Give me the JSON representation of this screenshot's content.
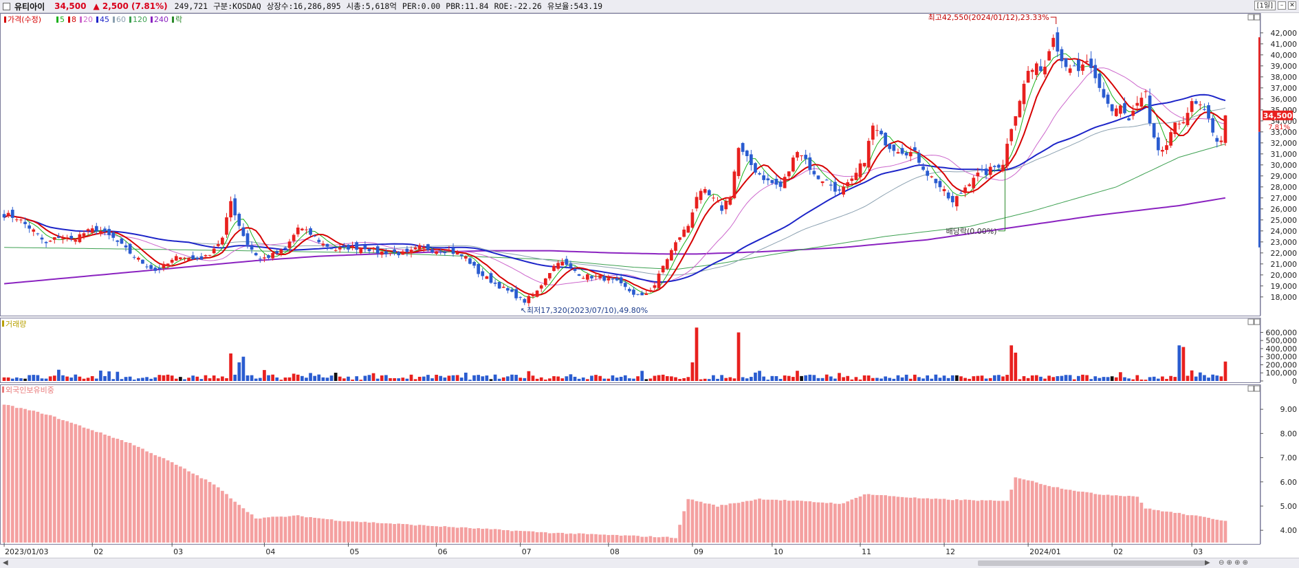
{
  "header": {
    "name": "유티아이",
    "price": "34,500",
    "change": "▲ 2,500 (7.81%)",
    "volume": "249,721",
    "market": "구분:KOSDAQ",
    "shares": "상장수:16,286,895",
    "marketcap": "시총:5,618억",
    "per": "PER:0.00",
    "pbr": "PBR:11.84",
    "roe": "ROE:-22.26",
    "float": "유보율:543.19",
    "period_button": "[1일]"
  },
  "legend": [
    {
      "label": "가격(수정)",
      "color": "#d60000"
    },
    {
      "label": "5",
      "color": "#19b019"
    },
    {
      "label": "8",
      "color": "#d60000"
    },
    {
      "label": "20",
      "color": "#cc66cc"
    },
    {
      "label": "45",
      "color": "#1c24c8"
    },
    {
      "label": "60",
      "color": "#8aa0b0"
    },
    {
      "label": "120",
      "color": "#3ca050"
    },
    {
      "label": "240",
      "color": "#8a22c0"
    },
    {
      "label": "락",
      "color": "#2a8a2a"
    }
  ],
  "chart_data": [
    {
      "type": "candlestick",
      "title": "가격(수정)",
      "y_ticks": [
        18000,
        19000,
        20000,
        21000,
        22000,
        23000,
        24000,
        25000,
        26000,
        27000,
        28000,
        29000,
        30000,
        31000,
        32000,
        33000,
        34000,
        35000,
        36000,
        37000,
        38000,
        39000,
        40000,
        41000,
        42000
      ],
      "y_tick_labels": [
        "18,000",
        "19,000",
        "20,000",
        "21,000",
        "22,000",
        "23,000",
        "24,000",
        "25,000",
        "26,000",
        "27,000",
        "28,000",
        "29,000",
        "30,000",
        "31,000",
        "32,000",
        "33,000",
        "34,000",
        "35,000",
        "36,000",
        "37,000",
        "38,000",
        "39,000",
        "40,000",
        "41,000",
        "42,000"
      ],
      "ylim": [
        16800,
        43300
      ],
      "x_axis": {
        "labels": [
          "2023/01/03",
          "02",
          "03",
          "04",
          "05",
          "06",
          "07",
          "08",
          "09",
          "10",
          "11",
          "12",
          "2024/01",
          "02",
          "03"
        ],
        "positions": [
          0,
          21,
          40,
          62,
          82,
          103,
          123,
          144,
          164,
          183,
          204,
          224,
          244,
          264,
          283
        ]
      },
      "trading_days": 292,
      "price_path": [
        [
          0,
          25500
        ],
        [
          3,
          25200
        ],
        [
          7,
          24000
        ],
        [
          10,
          22800
        ],
        [
          13,
          23500
        ],
        [
          16,
          23200
        ],
        [
          19,
          23800
        ],
        [
          22,
          24200
        ],
        [
          26,
          23300
        ],
        [
          29,
          22300
        ],
        [
          33,
          21100
        ],
        [
          36,
          20400
        ],
        [
          39,
          21000
        ],
        [
          42,
          21800
        ],
        [
          45,
          21400
        ],
        [
          48,
          21600
        ],
        [
          52,
          23300
        ],
        [
          54,
          26700
        ],
        [
          56,
          24500
        ],
        [
          58,
          22800
        ],
        [
          61,
          21400
        ],
        [
          64,
          21800
        ],
        [
          67,
          22300
        ],
        [
          70,
          24300
        ],
        [
          73,
          23700
        ],
        [
          76,
          22800
        ],
        [
          79,
          22300
        ],
        [
          82,
          22500
        ],
        [
          86,
          22500
        ],
        [
          89,
          22100
        ],
        [
          93,
          22000
        ],
        [
          96,
          21900
        ],
        [
          99,
          22500
        ],
        [
          102,
          22300
        ],
        [
          106,
          22200
        ],
        [
          110,
          21600
        ],
        [
          113,
          20200
        ],
        [
          117,
          19200
        ],
        [
          121,
          18300
        ],
        [
          124,
          17600
        ],
        [
          127,
          18500
        ],
        [
          129,
          19800
        ],
        [
          132,
          21300
        ],
        [
          135,
          20600
        ],
        [
          138,
          19900
        ],
        [
          142,
          19800
        ],
        [
          146,
          19300
        ],
        [
          150,
          18300
        ],
        [
          152,
          18000
        ],
        [
          155,
          19100
        ],
        [
          157,
          20800
        ],
        [
          159,
          22200
        ],
        [
          161,
          23500
        ],
        [
          163,
          24500
        ],
        [
          165,
          27200
        ],
        [
          167,
          27500
        ],
        [
          169,
          26800
        ],
        [
          171,
          26000
        ],
        [
          173,
          27300
        ],
        [
          175,
          31500
        ],
        [
          177,
          30500
        ],
        [
          179,
          29500
        ],
        [
          182,
          28500
        ],
        [
          185,
          28000
        ],
        [
          187,
          29500
        ],
        [
          189,
          31500
        ],
        [
          191,
          30500
        ],
        [
          193,
          29000
        ],
        [
          196,
          28500
        ],
        [
          199,
          27500
        ],
        [
          202,
          28500
        ],
        [
          205,
          30500
        ],
        [
          207,
          33500
        ],
        [
          209,
          32500
        ],
        [
          211,
          31700
        ],
        [
          214,
          31300
        ],
        [
          217,
          31000
        ],
        [
          220,
          29200
        ],
        [
          222,
          28500
        ],
        [
          224,
          27500
        ],
        [
          226,
          26500
        ],
        [
          228,
          27500
        ],
        [
          231,
          29000
        ],
        [
          234,
          29300
        ],
        [
          236,
          29800
        ],
        [
          238,
          30200
        ],
        [
          240,
          33500
        ],
        [
          242,
          36000
        ],
        [
          244,
          38500
        ],
        [
          246,
          38800
        ],
        [
          248,
          39000
        ],
        [
          250,
          42000
        ],
        [
          252,
          39500
        ],
        [
          254,
          39000
        ],
        [
          256,
          38300
        ],
        [
          258,
          39500
        ],
        [
          260,
          37500
        ],
        [
          262,
          36000
        ],
        [
          264,
          35000
        ],
        [
          266,
          35400
        ],
        [
          268,
          34000
        ],
        [
          270,
          35500
        ],
        [
          272,
          36500
        ],
        [
          273,
          33500
        ],
        [
          275,
          31000
        ],
        [
          277,
          31800
        ],
        [
          279,
          33500
        ],
        [
          281,
          34200
        ],
        [
          283,
          35500
        ],
        [
          285,
          35300
        ],
        [
          287,
          34000
        ],
        [
          289,
          32300
        ],
        [
          290,
          32000
        ],
        [
          291,
          34500
        ]
      ],
      "moving_averages": {
        "MA240_anchors": [
          [
            0,
            19200
          ],
          [
            20,
            19900
          ],
          [
            40,
            20600
          ],
          [
            60,
            21300
          ],
          [
            75,
            21700
          ],
          [
            95,
            22000
          ],
          [
            115,
            22200
          ],
          [
            130,
            22200
          ],
          [
            145,
            22000
          ],
          [
            158,
            21900
          ],
          [
            165,
            21900
          ],
          [
            180,
            22100
          ],
          [
            200,
            22500
          ],
          [
            220,
            23200
          ],
          [
            240,
            24300
          ],
          [
            260,
            25400
          ],
          [
            280,
            26300
          ],
          [
            291,
            27000
          ]
        ],
        "MA120_anchors": [
          [
            0,
            22500
          ],
          [
            40,
            22300
          ],
          [
            90,
            22000
          ],
          [
            130,
            21400
          ],
          [
            150,
            20700
          ],
          [
            160,
            20500
          ],
          [
            170,
            21000
          ],
          [
            190,
            22300
          ],
          [
            210,
            23500
          ],
          [
            230,
            24400
          ],
          [
            245,
            25800
          ],
          [
            265,
            28000
          ],
          [
            280,
            30700
          ],
          [
            291,
            31900
          ]
        ]
      },
      "annotations": [
        {
          "text": "최고42,550(2024/01/12),23.33%",
          "x_day": 250,
          "y": 42550,
          "color": "#c00000"
        },
        {
          "text": "최저17,320(2023/07/10),49.80%",
          "x_day": 124,
          "y": 17320,
          "color": "#1a3a8a"
        },
        {
          "text": "배당락(0.00%)",
          "x_day": 238,
          "y": 24000,
          "color": "#2a8a2a"
        }
      ],
      "last_price_label": "34,500",
      "last_change_label": "7.81%"
    },
    {
      "type": "bar",
      "title": "거래량",
      "y_ticks": [
        0,
        100000,
        200000,
        300000,
        400000,
        500000,
        600000
      ],
      "y_tick_labels": [
        "0",
        "100,000",
        "200,000",
        "300,000",
        "400,000",
        "500,000",
        "600,000"
      ],
      "ylim": [
        0,
        680000
      ],
      "spikes": [
        [
          54,
          340000
        ],
        [
          56,
          230000
        ],
        [
          57,
          300000
        ],
        [
          164,
          230000
        ],
        [
          165,
          660000
        ],
        [
          175,
          600000
        ],
        [
          240,
          440000
        ],
        [
          241,
          350000
        ],
        [
          280,
          440000
        ],
        [
          281,
          420000
        ],
        [
          291,
          240000
        ]
      ]
    },
    {
      "type": "bar",
      "title": "외국인보유비중",
      "y_ticks": [
        4,
        5,
        6,
        7,
        8,
        9
      ],
      "y_tick_labels": [
        "4.00",
        "5.00",
        "6.00",
        "7.00",
        "8.00",
        "9.00"
      ],
      "ylim": [
        3.55,
        9.8
      ],
      "anchors": [
        [
          0,
          9.2
        ],
        [
          10,
          8.8
        ],
        [
          20,
          8.2
        ],
        [
          30,
          7.6
        ],
        [
          40,
          6.8
        ],
        [
          50,
          5.9
        ],
        [
          60,
          4.5
        ],
        [
          70,
          4.6
        ],
        [
          80,
          4.4
        ],
        [
          100,
          4.2
        ],
        [
          130,
          3.9
        ],
        [
          160,
          3.7
        ],
        [
          163,
          5.3
        ],
        [
          170,
          5.0
        ],
        [
          180,
          5.3
        ],
        [
          200,
          5.1
        ],
        [
          205,
          5.5
        ],
        [
          220,
          5.3
        ],
        [
          239,
          5.2
        ],
        [
          241,
          6.2
        ],
        [
          250,
          5.8
        ],
        [
          260,
          5.5
        ],
        [
          270,
          5.4
        ],
        [
          272,
          4.9
        ],
        [
          280,
          4.7
        ],
        [
          291,
          4.4
        ]
      ]
    }
  ]
}
